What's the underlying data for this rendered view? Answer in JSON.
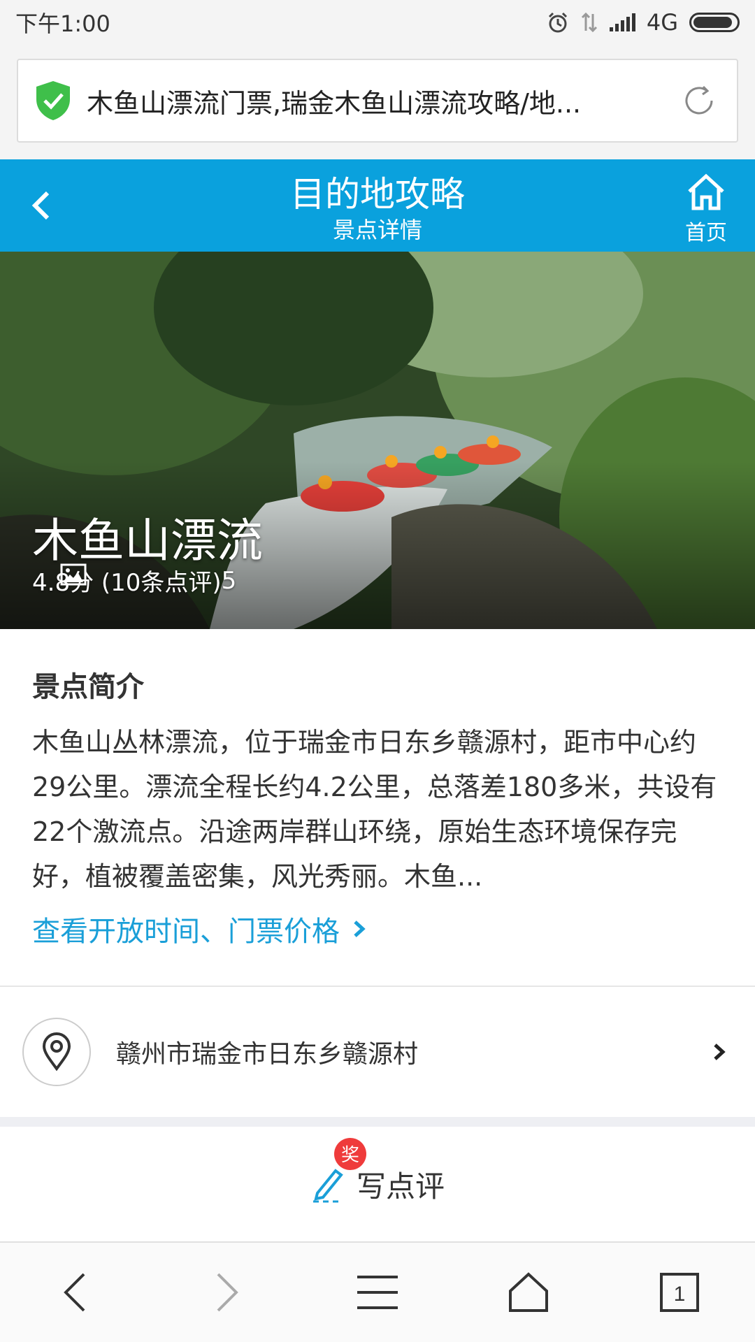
{
  "status_bar": {
    "time": "下午1:00",
    "network": "4G"
  },
  "url_bar": {
    "title": "木鱼山漂流门票,瑞金木鱼山漂流攻略/地..."
  },
  "header": {
    "title": "目的地攻略",
    "subtitle": "景点详情",
    "home_label": "首页"
  },
  "hero": {
    "name": "木鱼山漂流",
    "rating_text": "4.8分 (10条点评)",
    "photo_count": "5"
  },
  "intro": {
    "title": "景点简介",
    "body": "木鱼山丛林漂流，位于瑞金市日东乡赣源村，距市中心约29公里。漂流全程长约4.2公里，总落差180多米，共设有22个激流点。沿途两岸群山环绕，原始生态环境保存完好，植被覆盖密集，风光秀丽。木鱼...",
    "link_text": "查看开放时间、门票价格"
  },
  "address": {
    "text": "赣州市瑞金市日东乡赣源村"
  },
  "review": {
    "badge": "奖",
    "label": "写点评"
  },
  "bottom_nav": {
    "tab_count": "1"
  },
  "colors": {
    "header_blue": "#0aa1dd",
    "link_blue": "#1a9fd8",
    "shield_green": "#3fbf4a",
    "badge_red": "#ef3b3b"
  }
}
